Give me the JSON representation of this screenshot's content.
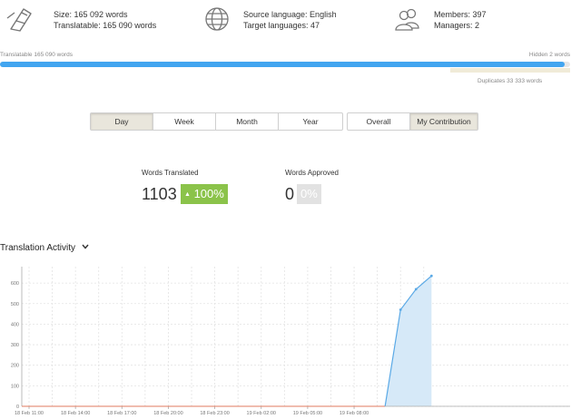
{
  "stats": {
    "size": "Size: 165 092 words",
    "translatable": "Translatable: 165 090 words",
    "source_language": "Source language: English",
    "target_languages": "Target languages: 47",
    "members": "Members: 397",
    "managers": "Managers: 2"
  },
  "progress": {
    "translatable_label": "Translatable 165 090 words",
    "hidden_label": "Hidden 2 words",
    "duplicates_label": "Duplicates 33 333 words",
    "fraction": 0.99
  },
  "periods": [
    {
      "label": "Day",
      "active": true
    },
    {
      "label": "Week",
      "active": false
    },
    {
      "label": "Month",
      "active": false
    },
    {
      "label": "Year",
      "active": false
    }
  ],
  "scope": [
    {
      "label": "Overall",
      "active": false
    },
    {
      "label": "My Contribution",
      "active": true
    }
  ],
  "metrics": {
    "translated_label": "Words Translated",
    "translated_value": "1103",
    "translated_change": "100%",
    "approved_label": "Words Approved",
    "approved_value": "0",
    "approved_change": "0%"
  },
  "activity": {
    "title": "Translation Activity"
  },
  "colors": {
    "progress": "#42a5f0",
    "green_badge": "#8bc34a",
    "line": "#5aa9e6",
    "area": "#d6e9f8",
    "baseline": "#e07a5f"
  },
  "chart_data": {
    "type": "area",
    "x_ticks": [
      "18 Feb 11:00",
      "18 Feb 14:00",
      "18 Feb 17:00",
      "18 Feb 20:00",
      "18 Feb 23:00",
      "19 Feb 02:00",
      "19 Feb 05:00",
      "19 Feb 08:00"
    ],
    "y_ticks": [
      0,
      100,
      200,
      300,
      400,
      500,
      600
    ],
    "ylim": [
      0,
      680
    ],
    "x_hours": [
      0,
      23,
      24,
      25,
      26
    ],
    "values": [
      0,
      0,
      470,
      570,
      635
    ],
    "x_start_label": "18 Feb 11:00",
    "grid": true
  }
}
